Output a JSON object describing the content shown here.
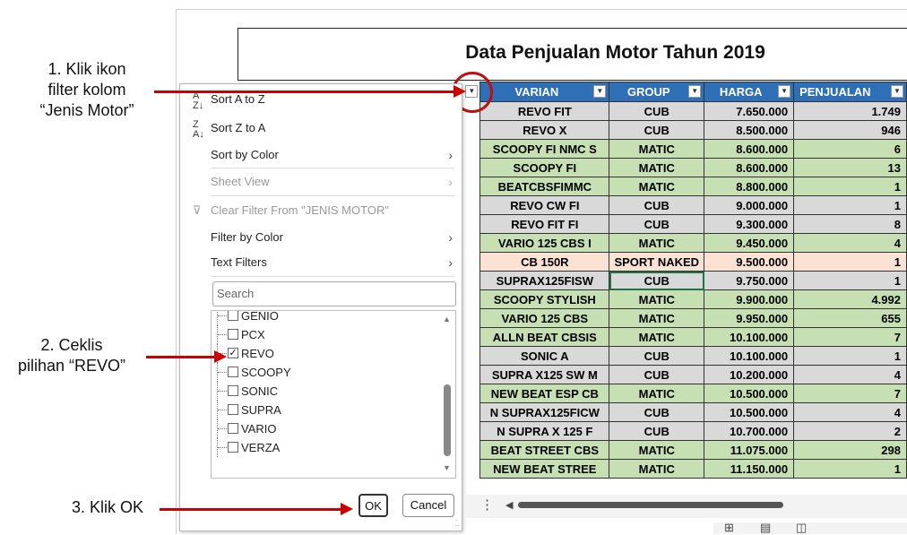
{
  "annotations": {
    "step1": "1. Klik ikon\nfilter kolom\n“Jenis Motor”",
    "step2": "2. Ceklis\npilihan “REVO”",
    "step3": "3. Klik OK"
  },
  "sheet": {
    "title": "Data Penjualan Motor Tahun 2019",
    "headers": [
      "VARIAN",
      "GROUP",
      "HARGA",
      "PENJUALAN"
    ],
    "rows": [
      {
        "varian": "REVO FIT",
        "group": "CUB",
        "harga": "7.650.000",
        "penjualan": "1.749",
        "color": "grey"
      },
      {
        "varian": "REVO X",
        "group": "CUB",
        "harga": "8.500.000",
        "penjualan": "946",
        "color": "grey"
      },
      {
        "varian": "SCOOPY FI NMC S",
        "group": "MATIC",
        "harga": "8.600.000",
        "penjualan": "6",
        "color": "green"
      },
      {
        "varian": "SCOOPY FI",
        "group": "MATIC",
        "harga": "8.600.000",
        "penjualan": "13",
        "color": "green"
      },
      {
        "varian": "BEATCBSFIMMC",
        "group": "MATIC",
        "harga": "8.800.000",
        "penjualan": "1",
        "color": "green"
      },
      {
        "varian": "REVO CW FI",
        "group": "CUB",
        "harga": "9.000.000",
        "penjualan": "1",
        "color": "grey"
      },
      {
        "varian": "REVO FIT FI",
        "group": "CUB",
        "harga": "9.300.000",
        "penjualan": "8",
        "color": "grey"
      },
      {
        "varian": "VARIO 125 CBS I",
        "group": "MATIC",
        "harga": "9.450.000",
        "penjualan": "4",
        "color": "green"
      },
      {
        "varian": "CB 150R",
        "group": "SPORT NAKED",
        "harga": "9.500.000",
        "penjualan": "1",
        "color": "peach"
      },
      {
        "varian": "SUPRAX125FISW",
        "group": "CUB",
        "harga": "9.750.000",
        "penjualan": "1",
        "color": "grey"
      },
      {
        "varian": "SCOOPY STYLISH",
        "group": "MATIC",
        "harga": "9.900.000",
        "penjualan": "4.992",
        "color": "green"
      },
      {
        "varian": "VARIO 125 CBS",
        "group": "MATIC",
        "harga": "9.950.000",
        "penjualan": "655",
        "color": "green"
      },
      {
        "varian": "ALLN BEAT CBSIS",
        "group": "MATIC",
        "harga": "10.100.000",
        "penjualan": "7",
        "color": "green"
      },
      {
        "varian": "SONIC A",
        "group": "CUB",
        "harga": "10.100.000",
        "penjualan": "1",
        "color": "grey"
      },
      {
        "varian": "SUPRA X125 SW M",
        "group": "CUB",
        "harga": "10.200.000",
        "penjualan": "4",
        "color": "grey"
      },
      {
        "varian": "NEW BEAT ESP CB",
        "group": "MATIC",
        "harga": "10.500.000",
        "penjualan": "7",
        "color": "green"
      },
      {
        "varian": "N SUPRAX125FICW",
        "group": "CUB",
        "harga": "10.500.000",
        "penjualan": "4",
        "color": "grey"
      },
      {
        "varian": "N SUPRA X 125 F",
        "group": "CUB",
        "harga": "10.700.000",
        "penjualan": "2",
        "color": "grey"
      },
      {
        "varian": "BEAT STREET CBS",
        "group": "MATIC",
        "harga": "11.075.000",
        "penjualan": "298",
        "color": "green"
      },
      {
        "varian": "NEW BEAT STREE",
        "group": "MATIC",
        "harga": "11.150.000",
        "penjualan": "1",
        "color": "green"
      }
    ]
  },
  "filter_menu": {
    "sort_az": "Sort A to Z",
    "sort_za": "Sort Z to A",
    "sort_color": "Sort by Color",
    "sheet_view": "Sheet View",
    "clear_filter": "Clear Filter From \"JENIS MOTOR\"",
    "filter_color": "Filter by Color",
    "text_filters": "Text Filters",
    "search_placeholder": "Search",
    "items": [
      {
        "label": "GENIO",
        "checked": false
      },
      {
        "label": "PCX",
        "checked": false
      },
      {
        "label": "REVO",
        "checked": true
      },
      {
        "label": "SCOOPY",
        "checked": false
      },
      {
        "label": "SONIC",
        "checked": false
      },
      {
        "label": "SUPRA",
        "checked": false
      },
      {
        "label": "VARIO",
        "checked": false
      },
      {
        "label": "VERZA",
        "checked": false
      }
    ],
    "ok": "OK",
    "cancel": "Cancel"
  },
  "colors": {
    "header": "#2f6fb5",
    "green": "#c6e0b4",
    "grey": "#d9d9d9",
    "peach": "#fbe2d5",
    "arrow": "#c00000"
  }
}
